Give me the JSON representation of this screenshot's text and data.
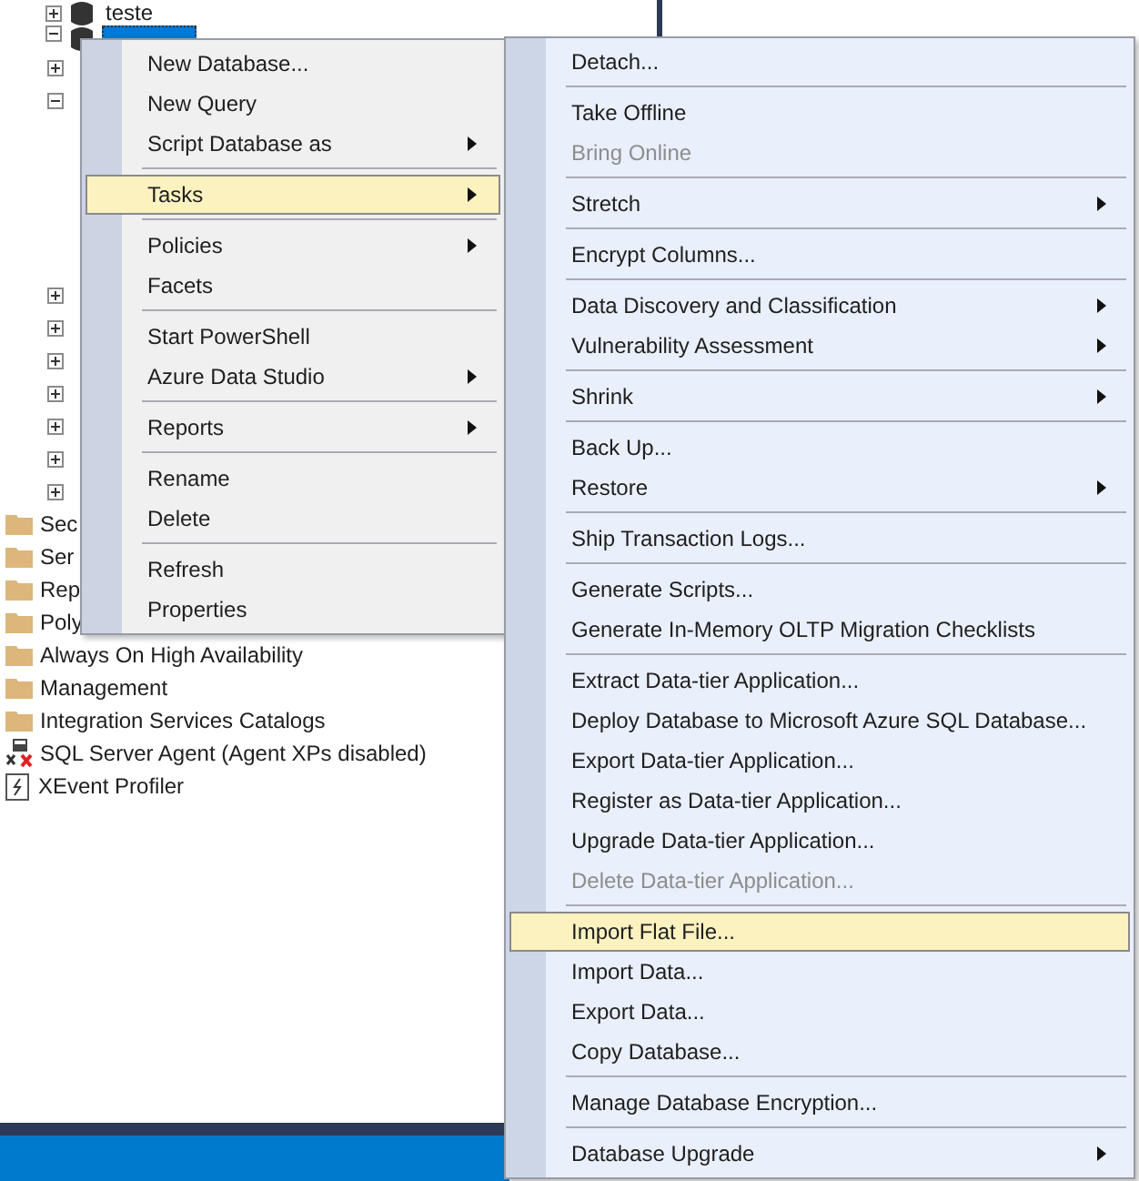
{
  "tree": {
    "top_nodes": [
      {
        "label": "teste",
        "expanded": false,
        "selected": false
      },
      {
        "expanded": true,
        "selected": true
      }
    ],
    "child_expanders": [
      {
        "expanded": false
      },
      {
        "expanded": true
      }
    ],
    "lower_expanders": [
      {
        "expanded": false
      },
      {
        "expanded": false
      },
      {
        "expanded": false
      },
      {
        "expanded": false
      },
      {
        "expanded": false
      },
      {
        "expanded": false
      },
      {
        "expanded": false
      }
    ],
    "nodes": [
      {
        "label": "Sec",
        "kind": "folder"
      },
      {
        "label": "Ser",
        "kind": "folder"
      },
      {
        "label": "Rep",
        "kind": "folder"
      },
      {
        "label": "Poly",
        "kind": "folder"
      },
      {
        "label": "Always On High Availability",
        "kind": "folder"
      },
      {
        "label": "Management",
        "kind": "folder"
      },
      {
        "label": "Integration Services Catalogs",
        "kind": "folder"
      },
      {
        "label": "SQL Server Agent (Agent XPs disabled)",
        "kind": "agent"
      },
      {
        "label": "XEvent Profiler",
        "kind": "profiler"
      }
    ]
  },
  "context_menu": {
    "items": [
      {
        "kind": "item",
        "label": "New Database...",
        "submenu": false,
        "selected": false,
        "disabled": false
      },
      {
        "kind": "item",
        "label": "New Query",
        "submenu": false,
        "selected": false,
        "disabled": false
      },
      {
        "kind": "item",
        "label": "Script Database as",
        "submenu": true,
        "selected": false,
        "disabled": false
      },
      {
        "kind": "separator"
      },
      {
        "kind": "item",
        "label": "Tasks",
        "submenu": true,
        "selected": true,
        "disabled": false
      },
      {
        "kind": "separator"
      },
      {
        "kind": "item",
        "label": "Policies",
        "submenu": true,
        "selected": false,
        "disabled": false
      },
      {
        "kind": "item",
        "label": "Facets",
        "submenu": false,
        "selected": false,
        "disabled": false
      },
      {
        "kind": "separator"
      },
      {
        "kind": "item",
        "label": "Start PowerShell",
        "submenu": false,
        "selected": false,
        "disabled": false
      },
      {
        "kind": "item",
        "label": "Azure Data Studio",
        "submenu": true,
        "selected": false,
        "disabled": false
      },
      {
        "kind": "separator"
      },
      {
        "kind": "item",
        "label": "Reports",
        "submenu": true,
        "selected": false,
        "disabled": false
      },
      {
        "kind": "separator"
      },
      {
        "kind": "item",
        "label": "Rename",
        "submenu": false,
        "selected": false,
        "disabled": false
      },
      {
        "kind": "item",
        "label": "Delete",
        "submenu": false,
        "selected": false,
        "disabled": false
      },
      {
        "kind": "separator"
      },
      {
        "kind": "item",
        "label": "Refresh",
        "submenu": false,
        "selected": false,
        "disabled": false
      },
      {
        "kind": "item",
        "label": "Properties",
        "submenu": false,
        "selected": false,
        "disabled": false
      }
    ]
  },
  "tasks_submenu": {
    "items": [
      {
        "kind": "item",
        "label": "Detach...",
        "submenu": false,
        "selected": false,
        "disabled": false
      },
      {
        "kind": "separator"
      },
      {
        "kind": "item",
        "label": "Take Offline",
        "submenu": false,
        "selected": false,
        "disabled": false
      },
      {
        "kind": "item",
        "label": "Bring Online",
        "submenu": false,
        "selected": false,
        "disabled": true
      },
      {
        "kind": "separator"
      },
      {
        "kind": "item",
        "label": "Stretch",
        "submenu": true,
        "selected": false,
        "disabled": false
      },
      {
        "kind": "separator"
      },
      {
        "kind": "item",
        "label": "Encrypt Columns...",
        "submenu": false,
        "selected": false,
        "disabled": false
      },
      {
        "kind": "separator"
      },
      {
        "kind": "item",
        "label": "Data Discovery and Classification",
        "submenu": true,
        "selected": false,
        "disabled": false
      },
      {
        "kind": "item",
        "label": "Vulnerability Assessment",
        "submenu": true,
        "selected": false,
        "disabled": false
      },
      {
        "kind": "separator"
      },
      {
        "kind": "item",
        "label": "Shrink",
        "submenu": true,
        "selected": false,
        "disabled": false
      },
      {
        "kind": "separator"
      },
      {
        "kind": "item",
        "label": "Back Up...",
        "submenu": false,
        "selected": false,
        "disabled": false
      },
      {
        "kind": "item",
        "label": "Restore",
        "submenu": true,
        "selected": false,
        "disabled": false
      },
      {
        "kind": "separator"
      },
      {
        "kind": "item",
        "label": "Ship Transaction Logs...",
        "submenu": false,
        "selected": false,
        "disabled": false
      },
      {
        "kind": "separator"
      },
      {
        "kind": "item",
        "label": "Generate Scripts...",
        "submenu": false,
        "selected": false,
        "disabled": false
      },
      {
        "kind": "item",
        "label": "Generate In-Memory OLTP Migration Checklists",
        "submenu": false,
        "selected": false,
        "disabled": false
      },
      {
        "kind": "separator"
      },
      {
        "kind": "item",
        "label": "Extract Data-tier Application...",
        "submenu": false,
        "selected": false,
        "disabled": false
      },
      {
        "kind": "item",
        "label": "Deploy Database to Microsoft Azure SQL Database...",
        "submenu": false,
        "selected": false,
        "disabled": false
      },
      {
        "kind": "item",
        "label": "Export Data-tier Application...",
        "submenu": false,
        "selected": false,
        "disabled": false
      },
      {
        "kind": "item",
        "label": "Register as Data-tier Application...",
        "submenu": false,
        "selected": false,
        "disabled": false
      },
      {
        "kind": "item",
        "label": "Upgrade Data-tier Application...",
        "submenu": false,
        "selected": false,
        "disabled": false
      },
      {
        "kind": "item",
        "label": "Delete Data-tier Application...",
        "submenu": false,
        "selected": false,
        "disabled": true
      },
      {
        "kind": "separator"
      },
      {
        "kind": "item",
        "label": "Import Flat File...",
        "submenu": false,
        "selected": true,
        "disabled": false
      },
      {
        "kind": "item",
        "label": "Import Data...",
        "submenu": false,
        "selected": false,
        "disabled": false
      },
      {
        "kind": "item",
        "label": "Export Data...",
        "submenu": false,
        "selected": false,
        "disabled": false
      },
      {
        "kind": "item",
        "label": "Copy Database...",
        "submenu": false,
        "selected": false,
        "disabled": false
      },
      {
        "kind": "separator"
      },
      {
        "kind": "item",
        "label": "Manage Database Encryption...",
        "submenu": false,
        "selected": false,
        "disabled": false
      },
      {
        "kind": "separator"
      },
      {
        "kind": "item",
        "label": "Database Upgrade",
        "submenu": true,
        "selected": false,
        "disabled": false
      }
    ]
  }
}
